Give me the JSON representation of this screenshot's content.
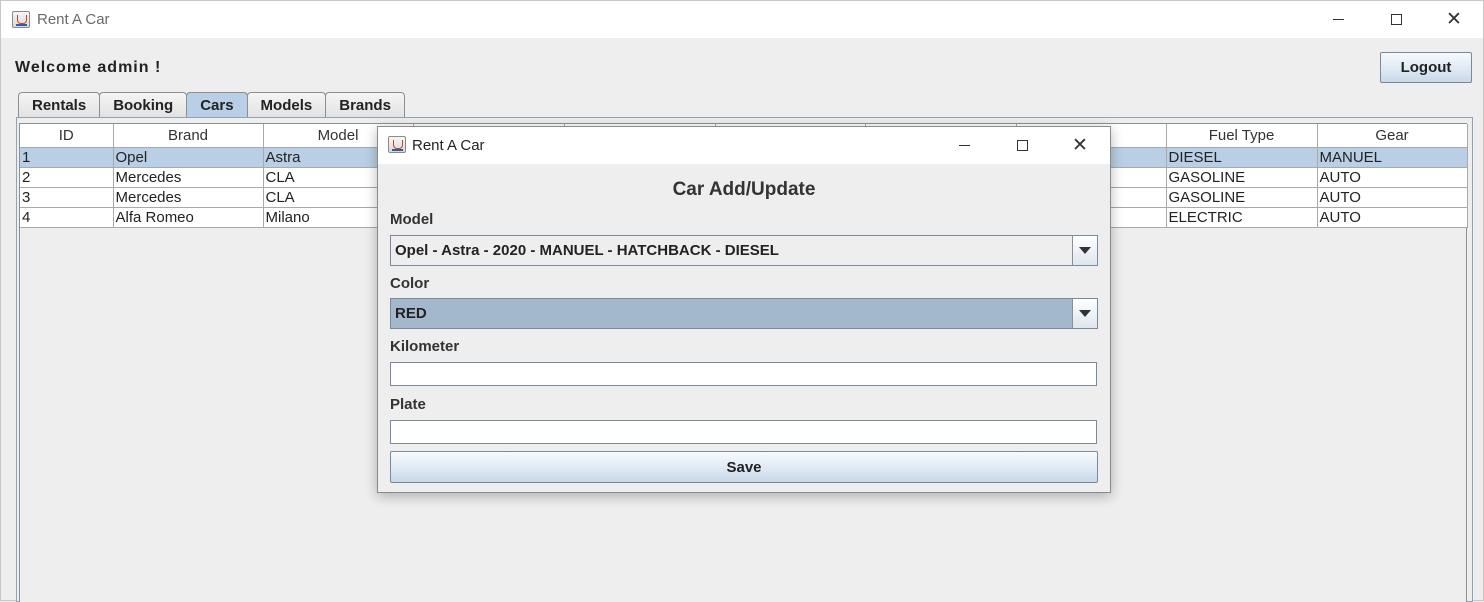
{
  "window": {
    "title": "Rent A Car"
  },
  "header": {
    "welcome": "Welcome admin !",
    "logout_label": "Logout"
  },
  "tabs": [
    {
      "label": "Rentals"
    },
    {
      "label": "Booking"
    },
    {
      "label": "Cars",
      "active": true
    },
    {
      "label": "Models"
    },
    {
      "label": "Brands"
    }
  ],
  "table": {
    "columns": [
      "ID",
      "Brand",
      "Model",
      "",
      "",
      "",
      "",
      "",
      "Fuel Type",
      "Gear"
    ],
    "rows": [
      {
        "id": "1",
        "brand": "Opel",
        "model": "Astra",
        "fuel": "DIESEL",
        "gear": "MANUEL",
        "selected": true
      },
      {
        "id": "2",
        "brand": "Mercedes",
        "model": "CLA",
        "fuel": "GASOLINE",
        "gear": "AUTO"
      },
      {
        "id": "3",
        "brand": "Mercedes",
        "model": "CLA",
        "fuel": "GASOLINE",
        "gear": "AUTO"
      },
      {
        "id": "4",
        "brand": "Alfa Romeo",
        "model": "Milano",
        "fuel": "ELECTRIC",
        "gear": "AUTO"
      }
    ]
  },
  "dialog": {
    "title": "Rent A Car",
    "heading": "Car Add/Update",
    "model_label": "Model",
    "model_value": "Opel - Astra - 2020 - MANUEL - HATCHBACK - DIESEL",
    "color_label": "Color",
    "color_value": "RED",
    "kilometer_label": "Kilometer",
    "kilometer_value": "",
    "plate_label": "Plate",
    "plate_value": "",
    "save_label": "Save"
  },
  "colors": {
    "selection": "#b8cfe5",
    "combo_highlight": "#a3b8cc",
    "background": "#eeeeee"
  }
}
